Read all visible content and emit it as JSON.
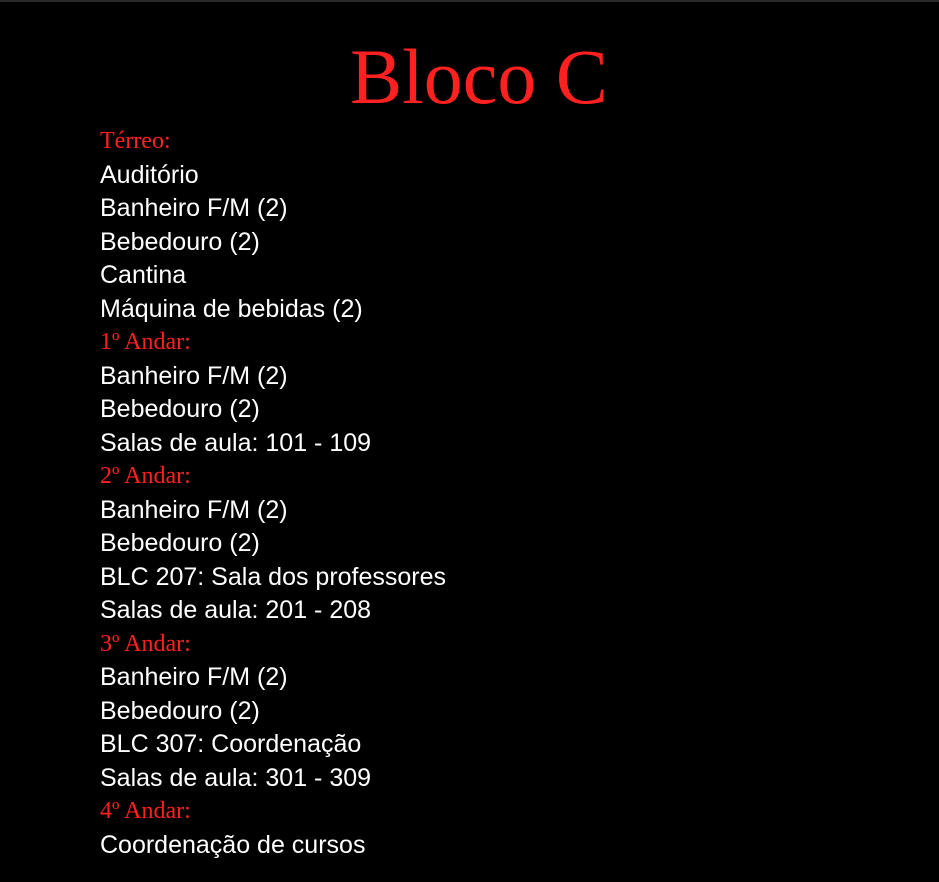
{
  "colors": {
    "background": "#000000",
    "heading": "#ff2020",
    "text": "#ffffff"
  },
  "page": {
    "title": "Bloco C"
  },
  "floors": [
    {
      "heading": "Térreo:",
      "items": [
        "Auditório",
        "Banheiro F/M (2)",
        "Bebedouro (2)",
        "Cantina",
        "Máquina de bebidas (2)"
      ]
    },
    {
      "heading": "1º Andar:",
      "items": [
        "Banheiro F/M (2)",
        "Bebedouro (2)",
        "Salas de aula: 101 - 109"
      ]
    },
    {
      "heading": "2º Andar:",
      "items": [
        "Banheiro F/M (2)",
        "Bebedouro (2)",
        "BLC 207: Sala dos professores",
        "Salas de aula: 201 - 208"
      ]
    },
    {
      "heading": "3º Andar:",
      "items": [
        "Banheiro F/M (2)",
        "Bebedouro (2)",
        "BLC 307: Coordenação",
        "Salas de aula: 301 - 309"
      ]
    },
    {
      "heading": "4º Andar:",
      "items": [
        "Coordenação de cursos"
      ]
    }
  ]
}
